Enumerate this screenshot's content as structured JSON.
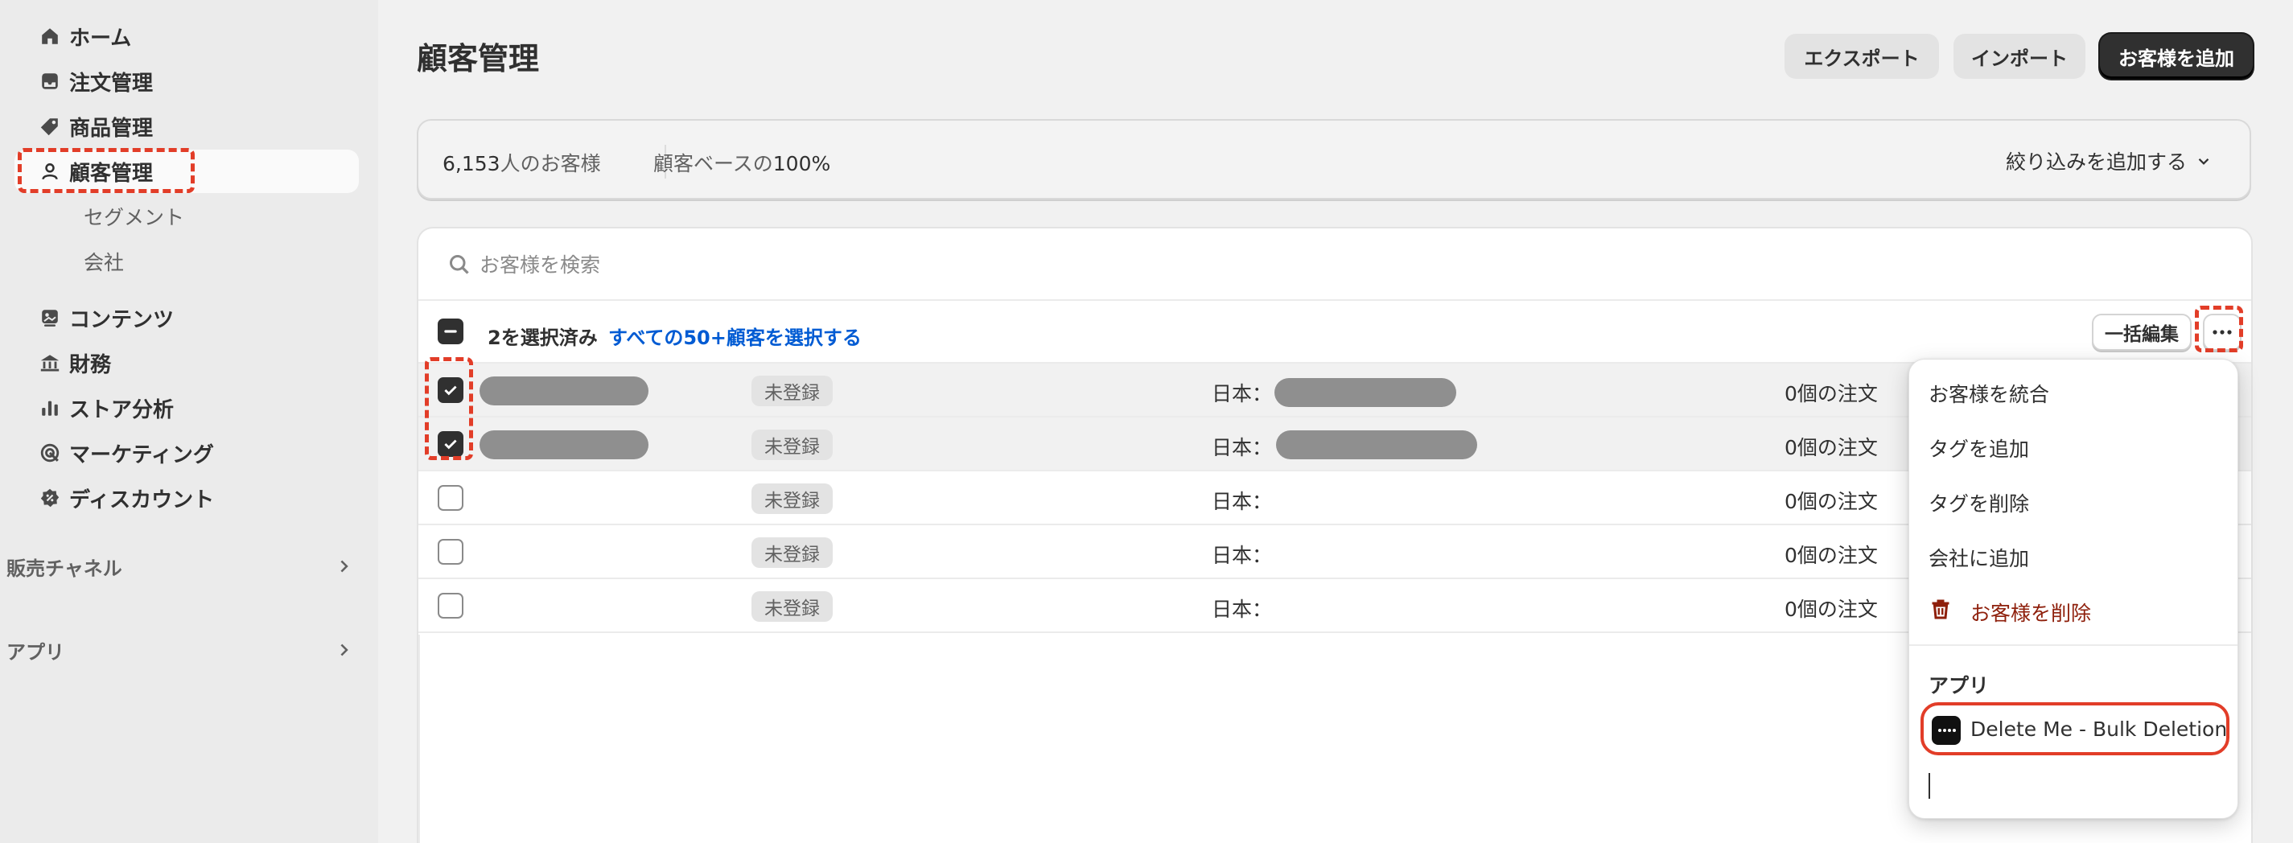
{
  "sidebar": {
    "items": [
      {
        "label": "ホーム",
        "icon": "home-icon"
      },
      {
        "label": "注文管理",
        "icon": "inbox-icon"
      },
      {
        "label": "商品管理",
        "icon": "tag-icon"
      },
      {
        "label": "顧客管理",
        "icon": "person-icon",
        "active": true
      },
      {
        "label": "セグメント"
      },
      {
        "label": "会社"
      },
      {
        "label": "コンテンツ",
        "icon": "content-icon"
      },
      {
        "label": "財務",
        "icon": "bank-icon"
      },
      {
        "label": "ストア分析",
        "icon": "bar-chart-icon"
      },
      {
        "label": "マーケティング",
        "icon": "target-icon"
      },
      {
        "label": "ディスカウント",
        "icon": "discount-icon"
      }
    ],
    "sections": [
      {
        "label": "販売チャネル"
      },
      {
        "label": "アプリ"
      }
    ]
  },
  "header": {
    "title": "顧客管理",
    "export_label": "エクスポート",
    "import_label": "インポート",
    "add_label": "お客様を追加"
  },
  "stats": {
    "count_number": "6,153",
    "count_suffix": "人のお客様",
    "base_prefix": "顧客ベースの",
    "base_value": "100%",
    "filter_label": "絞り込みを追加する"
  },
  "table": {
    "search_placeholder": "お客様を検索",
    "selected_text": "2を選択済み",
    "select_all_link": "すべての50+顧客を選択する",
    "bulk_edit_label": "一括編集",
    "rows": [
      {
        "checked": true,
        "status": "未登録",
        "location": "日本：",
        "orders": "0個の注文"
      },
      {
        "checked": true,
        "status": "未登録",
        "location": "日本：",
        "orders": "0個の注文"
      },
      {
        "checked": false,
        "status": "未登録",
        "location": "日本：",
        "orders": "0個の注文"
      },
      {
        "checked": false,
        "status": "未登録",
        "location": "日本：",
        "orders": "0個の注文"
      },
      {
        "checked": false,
        "status": "未登録",
        "location": "日本：",
        "orders": "0個の注文"
      }
    ]
  },
  "menu": {
    "items": [
      "お客様を統合",
      "タグを追加",
      "タグを削除",
      "会社に追加"
    ],
    "delete_label": "お客様を削除",
    "apps_heading": "アプリ",
    "app_item_label": "Delete Me - Bulk Deletion"
  },
  "colors": {
    "accent_red": "#e23d28",
    "link_blue": "#005bd3",
    "danger": "#8e1f0b"
  }
}
